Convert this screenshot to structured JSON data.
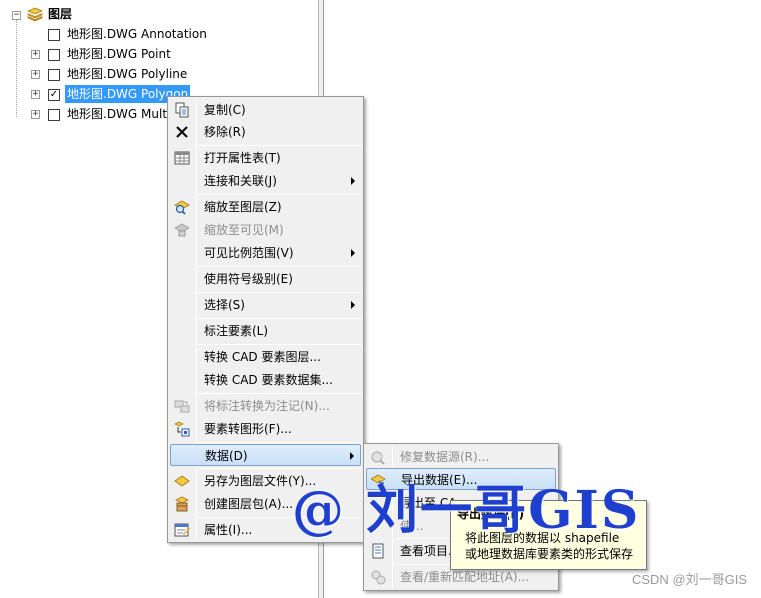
{
  "toc": {
    "root_label": "图层",
    "layers": [
      {
        "label": "地形图.DWG Annotation",
        "checked": false,
        "expandable": false
      },
      {
        "label": "地形图.DWG Point",
        "checked": false,
        "expandable": true
      },
      {
        "label": "地形图.DWG Polyline",
        "checked": false,
        "expandable": true
      },
      {
        "label": "地形图.DWG Polygon",
        "checked": true,
        "expandable": true
      },
      {
        "label": "地形图.DWG Mult",
        "checked": false,
        "expandable": true
      }
    ]
  },
  "context_menu": {
    "items": [
      {
        "label": "复制(C)",
        "icon": "copy-icon"
      },
      {
        "label": "移除(R)",
        "icon": "remove-icon"
      },
      {
        "label": "打开属性表(T)",
        "icon": "table-icon"
      },
      {
        "label": "连接和关联(J)"
      },
      {
        "label": "缩放至图层(Z)",
        "icon": "zoom-to-layer-icon"
      },
      {
        "label": "缩放至可见(M)",
        "icon": "zoom-visible-icon"
      },
      {
        "label": "可见比例范围(V)"
      },
      {
        "label": "使用符号级别(E)"
      },
      {
        "label": "选择(S)"
      },
      {
        "label": "标注要素(L)"
      },
      {
        "label": "转换 CAD 要素图层..."
      },
      {
        "label": "转换 CAD 要素数据集..."
      },
      {
        "label": "将标注转换为注记(N)...",
        "icon": "convert-labels-icon"
      },
      {
        "label": "要素转图形(F)...",
        "icon": "features-to-graphics-icon"
      },
      {
        "label": "数据(D)"
      },
      {
        "label": "另存为图层文件(Y)...",
        "icon": "layer-file-icon"
      },
      {
        "label": "创建图层包(A)...",
        "icon": "layer-package-icon"
      },
      {
        "label": "属性(I)...",
        "icon": "properties-icon"
      }
    ]
  },
  "submenu": {
    "items": [
      {
        "label": "修复数据源(R)...",
        "icon": "repair-icon"
      },
      {
        "label": "导出数据(E)...",
        "icon": "export-data-icon"
      },
      {
        "label": "导出至 CA"
      },
      {
        "label": "使..."
      },
      {
        "label": "查看项目..."
      },
      {
        "label": "查看/重新匹配地址(A)..."
      }
    ]
  },
  "tooltip": {
    "title": "导出数据(E)",
    "line1": "将此图层的数据以 shapefile",
    "line2": "或地理数据库要素类的形式保存"
  },
  "watermark": "@ 刘一哥GIS",
  "credit": "CSDN @刘一哥GIS",
  "colors": {
    "selection": "#3399ff",
    "watermark": "#1f3fcf",
    "menu_bg": "#f0f0f0",
    "tooltip_bg": "#ffffe1"
  }
}
